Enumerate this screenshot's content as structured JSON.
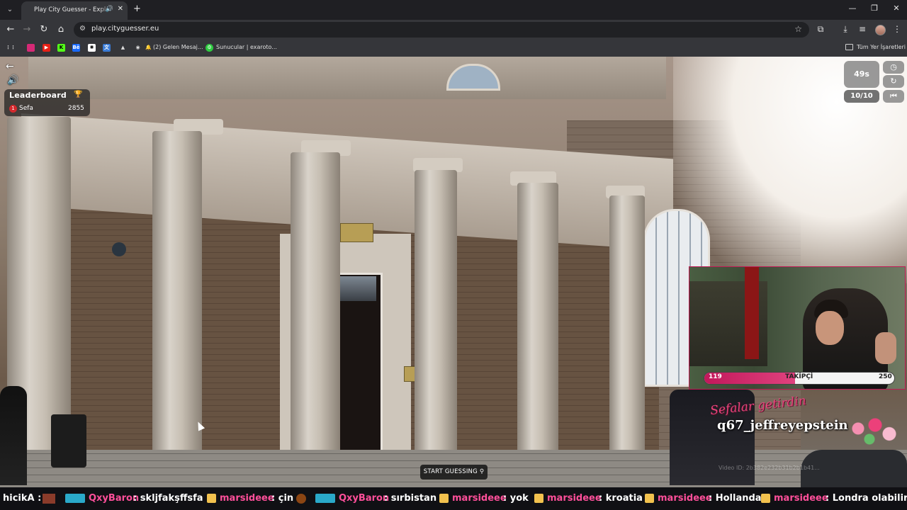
{
  "browser": {
    "tab_title": "Play City Guesser - Explore",
    "url": "play.cityguesser.eu",
    "bookmarks": [
      {
        "label": "(2) Gelen Mesaj..."
      },
      {
        "label": "Sunucular | exaroto..."
      }
    ],
    "all_bookmarks_label": "Tüm Yer İşaretleri"
  },
  "game": {
    "leaderboard": {
      "title": "Leaderboard",
      "entries": [
        {
          "rank": "1",
          "name": "Sefa",
          "score": "2855"
        }
      ]
    },
    "timer": "49s",
    "round": "10/10",
    "start_button": "START GUESSING"
  },
  "overlay": {
    "follower_goal": {
      "current": "119",
      "label": "TAKİPÇİ",
      "goal": "250",
      "progress": 0.476
    },
    "alert": {
      "message": "Sefalar getirdin",
      "username": "q67_jeffreyepstein"
    },
    "video_id": "Video ID: 2b382e232b31b2b1b41...",
    "chat_ticker": [
      {
        "user": "hicikA",
        "message": ""
      },
      {
        "user": "QxyBaron",
        "message": "skljfakşffsfa"
      },
      {
        "user": "marsideee",
        "message": "çin"
      },
      {
        "user": "QxyBaron",
        "message": "sırbistan"
      },
      {
        "user": "marsideee",
        "message": "yok"
      },
      {
        "user": "marsideee",
        "message": "kroatia"
      },
      {
        "user": "marsideee",
        "message": "Hollanda"
      },
      {
        "user": "marsideee",
        "message": "Londra olabilir"
      }
    ]
  },
  "colors": {
    "accent_pink": "#e0427e",
    "alert_red": "#d3292d",
    "chrome_bg": "#35363a"
  },
  "icons": [
    "back-arrow-icon",
    "sound-icon",
    "trophy-icon",
    "clock-icon",
    "refresh-icon",
    "skip-back-icon",
    "map-pin-icon"
  ]
}
